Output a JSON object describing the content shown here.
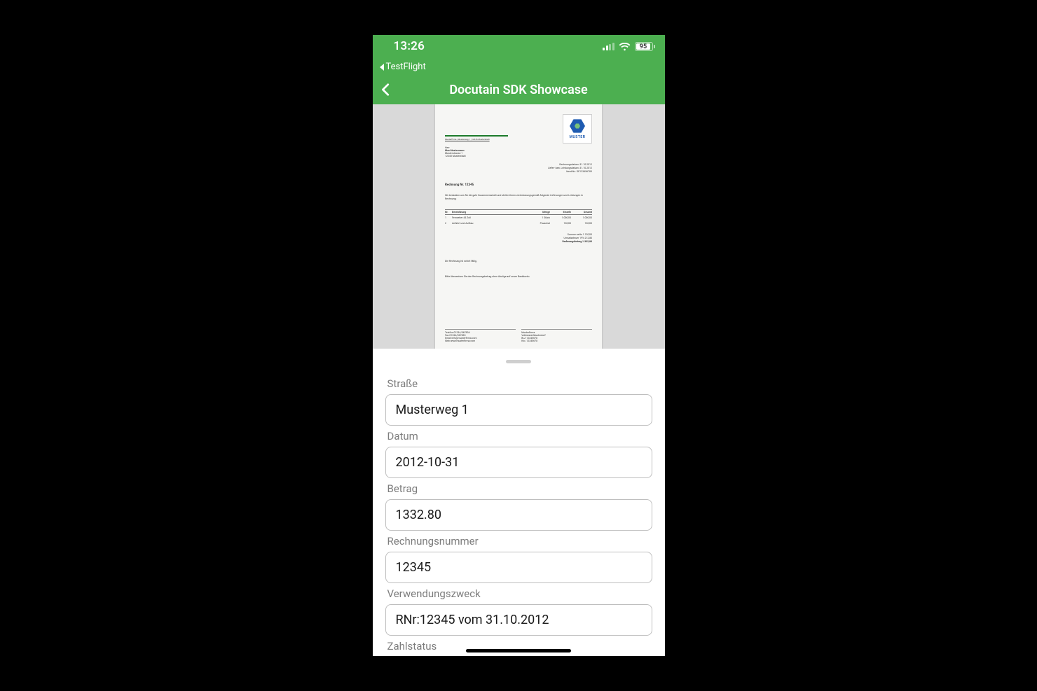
{
  "status": {
    "time": "13:26",
    "back_app": "TestFlight",
    "battery": "95"
  },
  "nav": {
    "title": "Docutain SDK Showcase"
  },
  "document": {
    "logo_text": "MUSTER",
    "sender_line": "Musterfirma | Musterweg 1 | 12345 Musterstadt",
    "recipient_l1": "Herr",
    "recipient_l2": "Max Mustermann",
    "recipient_l3": "Musterstrasse 1",
    "recipient_l4": "12345 Musterstadt",
    "meta_l1": "Rechnungsdatum:   31.10.2012",
    "meta_l2": "Liefer- bzw. Leistungsdatum:   31.10.2012",
    "meta_l3": "Ident-Nr.:   DE123456789",
    "title_line": "Rechnung Nr. 12345",
    "intro": "Wir bedanken uns für die gute Zusammenarbeit und stellen Ihnen vereinbarungsgemäß folgende Lieferungen und Leistungen in Rechnung:",
    "hdr_nr": "Nr.",
    "hdr_desc": "Bezeichnung",
    "hdr_qty": "Menge",
    "hdr_unit": "Einzeln",
    "hdr_total": "Gesamt",
    "r1_c1": "1",
    "r1_c2": "Fernseher 43 Zoll",
    "r1_c3": "1 Stück",
    "r1_c4": "1.000,00",
    "r1_c5": "1.000,00",
    "r2_c1": "2",
    "r2_c2": "Anfahrt und Aufbau",
    "r2_c3": "Pauschal",
    "r2_c4": "120,00",
    "r2_c5": "120,00",
    "sum_l1": "Summe netto    1.120,00",
    "sum_l2": "Umsatzsteuer 19%      212,80",
    "sum_l3": "Rechnungsbetrag    1.332,80",
    "note1": "Die Rechnung ist sofort fällig.",
    "note2": "Bitte überweisen Sie den Rechnungsbetrag ohne Abzüge auf unser Bankkonto.",
    "foot_left": "Telefon   01234/567834\nFax   01234/567835\nEmail   info@musterfirma.com\nWeb   www.musterfirma.com",
    "foot_right": "Musterfirma\nVolksbank Musterdorf\nBLZ 12345678\nKto. 12345678"
  },
  "form": {
    "strasse_label": "Straße",
    "strasse_value": "Musterweg 1",
    "datum_label": "Datum",
    "datum_value": "2012-10-31",
    "betrag_label": "Betrag",
    "betrag_value": "1332.80",
    "rechnungsnummer_label": "Rechnungsnummer",
    "rechnungsnummer_value": "12345",
    "verwendungszweck_label": "Verwendungszweck",
    "verwendungszweck_value": "RNr:12345 vom 31.10.2012",
    "zahlstatus_label": "Zahlstatus"
  }
}
